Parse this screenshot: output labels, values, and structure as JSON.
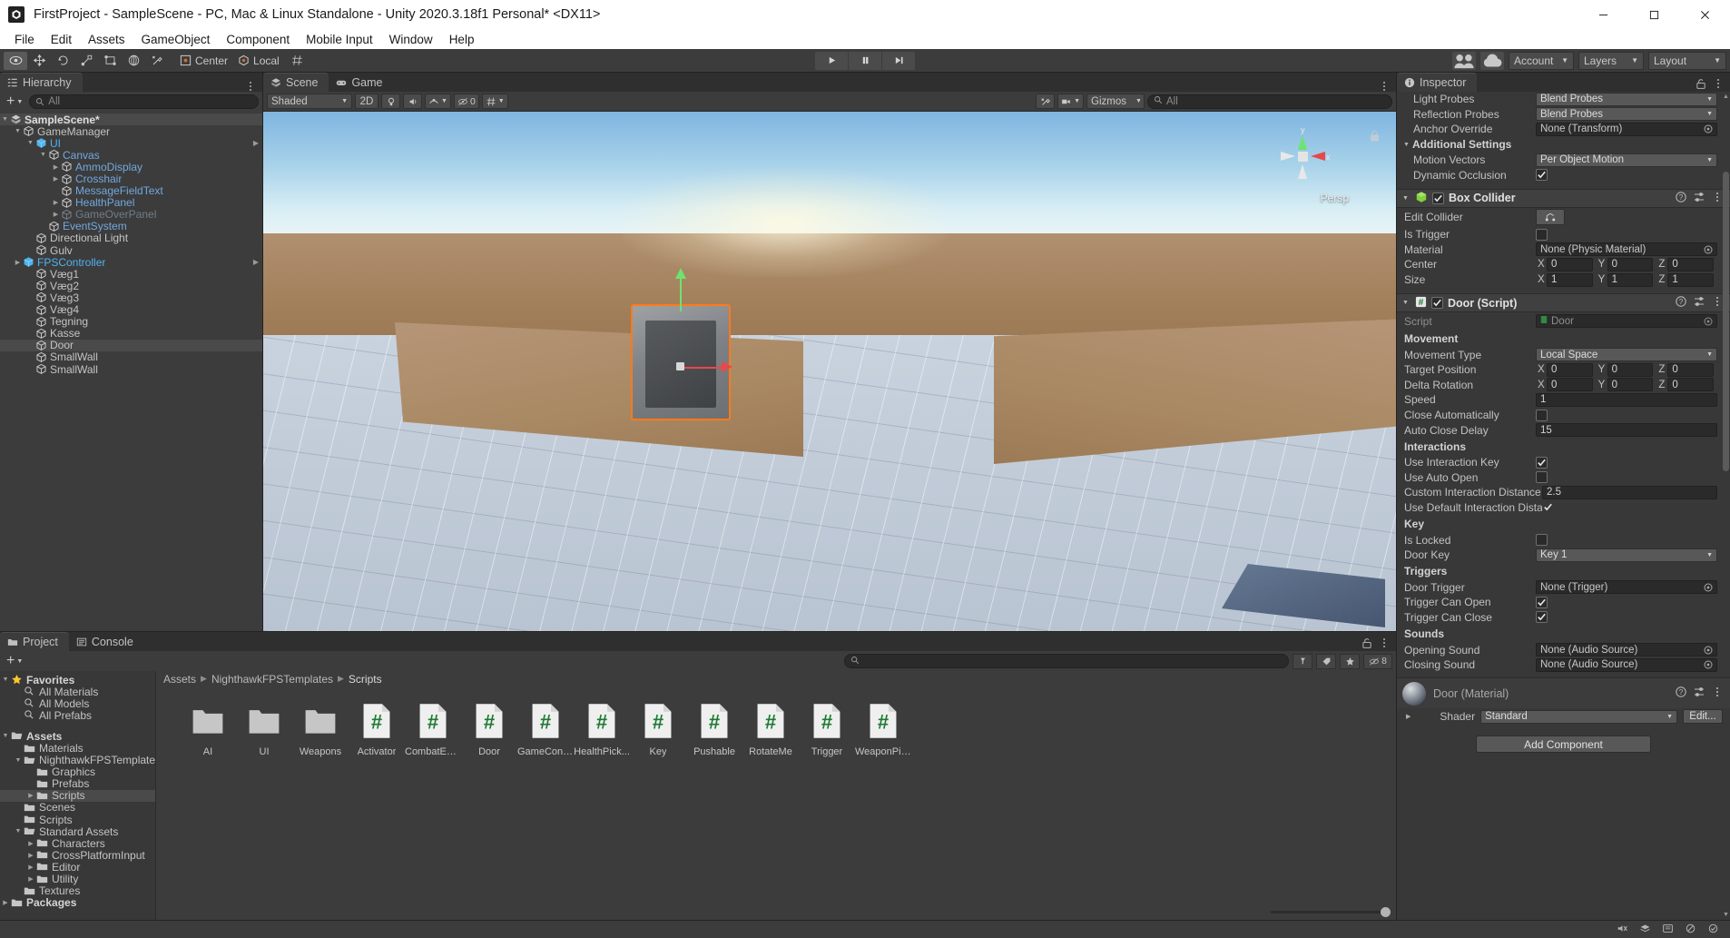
{
  "window": {
    "title": "FirstProject - SampleScene - PC, Mac & Linux Standalone - Unity 2020.3.18f1 Personal* <DX11>",
    "minimize_label": "Minimize",
    "maximize_label": "Maximize",
    "close_label": "Close"
  },
  "menubar": {
    "items": [
      "File",
      "Edit",
      "Assets",
      "GameObject",
      "Component",
      "Mobile Input",
      "Window",
      "Help"
    ]
  },
  "toolbar": {
    "tools": [
      "hand-tool",
      "move-tool",
      "rotate-tool",
      "scale-tool",
      "rect-tool",
      "transform-tool",
      "custom-editor-tool"
    ],
    "pivot_mode": "Center",
    "pivot_rotation": "Local",
    "grid_snap": "grid-snap",
    "play": "play-button",
    "pause": "pause-button",
    "step": "step-button",
    "collab": "collab-button",
    "cloud": "cloud-button",
    "account": "Account",
    "layers": "Layers",
    "layout": "Layout"
  },
  "hierarchy": {
    "tab": "Hierarchy",
    "search_placeholder": "All",
    "create_label": "+",
    "items": [
      {
        "label": "SampleScene*",
        "depth": 0,
        "arrow": "down",
        "icon": "scene-icon",
        "style": "scene",
        "selected": true
      },
      {
        "label": "GameManager",
        "depth": 1,
        "arrow": "down",
        "icon": "gameobject-icon",
        "style": "normal"
      },
      {
        "label": "UI",
        "depth": 2,
        "arrow": "down",
        "icon": "prefab-icon",
        "style": "prefab"
      },
      {
        "label": "Canvas",
        "depth": 3,
        "arrow": "down",
        "icon": "gameobject-icon",
        "style": "blue"
      },
      {
        "label": "AmmoDisplay",
        "depth": 4,
        "arrow": "right",
        "icon": "gameobject-icon",
        "style": "blue"
      },
      {
        "label": "Crosshair",
        "depth": 4,
        "arrow": "right",
        "icon": "gameobject-icon",
        "style": "blue"
      },
      {
        "label": "MessageFieldText",
        "depth": 4,
        "arrow": "none",
        "icon": "gameobject-icon",
        "style": "blue"
      },
      {
        "label": "HealthPanel",
        "depth": 4,
        "arrow": "right",
        "icon": "gameobject-icon",
        "style": "blue"
      },
      {
        "label": "GameOverPanel",
        "depth": 4,
        "arrow": "right",
        "icon": "gameobject-icon",
        "style": "dim"
      },
      {
        "label": "EventSystem",
        "depth": 3,
        "arrow": "none",
        "icon": "gameobject-icon",
        "style": "blue"
      },
      {
        "label": "Directional Light",
        "depth": 2,
        "arrow": "none",
        "icon": "gameobject-icon",
        "style": "normal"
      },
      {
        "label": "Gulv",
        "depth": 2,
        "arrow": "none",
        "icon": "gameobject-icon",
        "style": "normal"
      },
      {
        "label": "FPSController",
        "depth": 1,
        "arrow": "right",
        "icon": "prefab-icon",
        "style": "prefab"
      },
      {
        "label": "Væg1",
        "depth": 2,
        "arrow": "none",
        "icon": "gameobject-icon",
        "style": "normal"
      },
      {
        "label": "Væg2",
        "depth": 2,
        "arrow": "none",
        "icon": "gameobject-icon",
        "style": "normal"
      },
      {
        "label": "Væg3",
        "depth": 2,
        "arrow": "none",
        "icon": "gameobject-icon",
        "style": "normal"
      },
      {
        "label": "Væg4",
        "depth": 2,
        "arrow": "none",
        "icon": "gameobject-icon",
        "style": "normal"
      },
      {
        "label": "Tegning",
        "depth": 2,
        "arrow": "none",
        "icon": "gameobject-icon",
        "style": "normal"
      },
      {
        "label": "Kasse",
        "depth": 2,
        "arrow": "none",
        "icon": "gameobject-icon",
        "style": "normal"
      },
      {
        "label": "Door",
        "depth": 2,
        "arrow": "none",
        "icon": "gameobject-icon",
        "style": "normal",
        "selected": true
      },
      {
        "label": "SmallWall",
        "depth": 2,
        "arrow": "none",
        "icon": "gameobject-icon",
        "style": "normal"
      },
      {
        "label": "SmallWall",
        "depth": 2,
        "arrow": "none",
        "icon": "gameobject-icon",
        "style": "normal"
      }
    ]
  },
  "scene": {
    "tabs": [
      {
        "label": "Scene",
        "selected": true,
        "icon": "scene-tab-icon"
      },
      {
        "label": "Game",
        "selected": false,
        "icon": "game-tab-icon"
      }
    ],
    "draw_mode": "Shaded",
    "two_d": "2D",
    "gizmos": "Gizmos",
    "search_placeholder": "All",
    "perspective_label": "Persp",
    "axis_y": "y",
    "axis_x": "x"
  },
  "project": {
    "tabs": [
      {
        "label": "Project",
        "selected": true,
        "icon": "project-tab-icon"
      },
      {
        "label": "Console",
        "selected": false,
        "icon": "console-tab-icon"
      }
    ],
    "search_placeholder": "",
    "hidden_count": "8",
    "breadcrumb": [
      "Assets",
      "NighthawkFPSTemplates",
      "Scripts"
    ],
    "tree": [
      {
        "label": "Favorites",
        "depth": 0,
        "arrow": "down",
        "icon": "star-icon",
        "bold": true
      },
      {
        "label": "All Materials",
        "depth": 1,
        "arrow": "none",
        "icon": "search-icon"
      },
      {
        "label": "All Models",
        "depth": 1,
        "arrow": "none",
        "icon": "search-icon"
      },
      {
        "label": "All Prefabs",
        "depth": 1,
        "arrow": "none",
        "icon": "search-icon"
      },
      {
        "label": "",
        "depth": 0,
        "arrow": "none",
        "icon": "spacer"
      },
      {
        "label": "Assets",
        "depth": 0,
        "arrow": "down",
        "icon": "folder-open-icon",
        "bold": true
      },
      {
        "label": "Materials",
        "depth": 1,
        "arrow": "none",
        "icon": "folder-icon"
      },
      {
        "label": "NighthawkFPSTemplates",
        "depth": 1,
        "arrow": "down",
        "icon": "folder-open-icon"
      },
      {
        "label": "Graphics",
        "depth": 2,
        "arrow": "none",
        "icon": "folder-icon"
      },
      {
        "label": "Prefabs",
        "depth": 2,
        "arrow": "none",
        "icon": "folder-icon"
      },
      {
        "label": "Scripts",
        "depth": 2,
        "arrow": "right",
        "icon": "folder-icon",
        "selected": true
      },
      {
        "label": "Scenes",
        "depth": 1,
        "arrow": "none",
        "icon": "folder-icon"
      },
      {
        "label": "Scripts",
        "depth": 1,
        "arrow": "none",
        "icon": "folder-icon"
      },
      {
        "label": "Standard Assets",
        "depth": 1,
        "arrow": "down",
        "icon": "folder-open-icon"
      },
      {
        "label": "Characters",
        "depth": 2,
        "arrow": "right",
        "icon": "folder-icon"
      },
      {
        "label": "CrossPlatformInput",
        "depth": 2,
        "arrow": "right",
        "icon": "folder-icon"
      },
      {
        "label": "Editor",
        "depth": 2,
        "arrow": "right",
        "icon": "folder-icon"
      },
      {
        "label": "Utility",
        "depth": 2,
        "arrow": "right",
        "icon": "folder-icon"
      },
      {
        "label": "Textures",
        "depth": 1,
        "arrow": "none",
        "icon": "folder-icon"
      },
      {
        "label": "Packages",
        "depth": 0,
        "arrow": "right",
        "icon": "folder-icon",
        "bold": true
      }
    ],
    "assets": [
      {
        "name": "AI",
        "type": "folder"
      },
      {
        "name": "UI",
        "type": "folder"
      },
      {
        "name": "Weapons",
        "type": "folder"
      },
      {
        "name": "Activator",
        "type": "script"
      },
      {
        "name": "CombatEnt...",
        "type": "script"
      },
      {
        "name": "Door",
        "type": "script"
      },
      {
        "name": "GameCont...",
        "type": "script"
      },
      {
        "name": "HealthPick...",
        "type": "script"
      },
      {
        "name": "Key",
        "type": "script"
      },
      {
        "name": "Pushable",
        "type": "script"
      },
      {
        "name": "RotateMe",
        "type": "script"
      },
      {
        "name": "Trigger",
        "type": "script"
      },
      {
        "name": "WeaponPic...",
        "type": "script"
      }
    ]
  },
  "inspector": {
    "tab": "Inspector",
    "renderer_tail": {
      "light_probes_label": "Light Probes",
      "light_probes_value": "Blend Probes",
      "reflection_probes_label": "Reflection Probes",
      "reflection_probes_value": "Blend Probes",
      "anchor_override_label": "Anchor Override",
      "anchor_override_value": "None (Transform)",
      "additional_settings_label": "Additional Settings",
      "motion_vectors_label": "Motion Vectors",
      "motion_vectors_value": "Per Object Motion",
      "dynamic_occlusion_label": "Dynamic Occlusion",
      "dynamic_occlusion_value": true
    },
    "box_collider": {
      "title": "Box Collider",
      "enabled": true,
      "edit_collider_label": "Edit Collider",
      "is_trigger_label": "Is Trigger",
      "is_trigger_value": false,
      "material_label": "Material",
      "material_value": "None (Physic Material)",
      "center_label": "Center",
      "center": {
        "x": "0",
        "y": "0",
        "z": "0"
      },
      "size_label": "Size",
      "size": {
        "x": "1",
        "y": "1",
        "z": "1"
      }
    },
    "door_script": {
      "title": "Door (Script)",
      "enabled": true,
      "script_label": "Script",
      "script_value": "Door",
      "movement_group": "Movement",
      "movement_type_label": "Movement Type",
      "movement_type_value": "Local Space",
      "target_position_label": "Target Position",
      "target_position": {
        "x": "0",
        "y": "0",
        "z": "0"
      },
      "delta_rotation_label": "Delta Rotation",
      "delta_rotation": {
        "x": "0",
        "y": "0",
        "z": "0"
      },
      "speed_label": "Speed",
      "speed_value": "1",
      "close_automatically_label": "Close Automatically",
      "close_automatically_value": false,
      "auto_close_delay_label": "Auto Close Delay",
      "auto_close_delay_value": "15",
      "interactions_group": "Interactions",
      "use_interaction_key_label": "Use Interaction Key",
      "use_interaction_key_value": true,
      "use_auto_open_label": "Use Auto Open",
      "use_auto_open_value": false,
      "custom_interaction_distance_label": "Custom Interaction Distance",
      "custom_interaction_distance_value": "2.5",
      "use_default_interaction_label": "Use Default Interaction Dista",
      "use_default_interaction_value": true,
      "key_group": "Key",
      "is_locked_label": "Is Locked",
      "is_locked_value": false,
      "door_key_label": "Door Key",
      "door_key_value": "Key 1",
      "triggers_group": "Triggers",
      "door_trigger_label": "Door Trigger",
      "door_trigger_value": "None (Trigger)",
      "trigger_can_open_label": "Trigger Can Open",
      "trigger_can_open_value": true,
      "trigger_can_close_label": "Trigger Can Close",
      "trigger_can_close_value": true,
      "sounds_group": "Sounds",
      "opening_sound_label": "Opening Sound",
      "opening_sound_value": "None (Audio Source)",
      "closing_sound_label": "Closing Sound",
      "closing_sound_value": "None (Audio Source)"
    },
    "material": {
      "title": "Door (Material)",
      "shader_label": "Shader",
      "shader_value": "Standard",
      "edit_label": "Edit..."
    },
    "add_component": "Add Component"
  },
  "colors": {
    "accent_orange": "#ff7a1a",
    "prefab_blue": "#4fb3ef",
    "child_blue": "#71a8e0",
    "panel_bg": "#383838",
    "header_bg": "#3c3c3c",
    "script_green": "#1e7a32"
  }
}
